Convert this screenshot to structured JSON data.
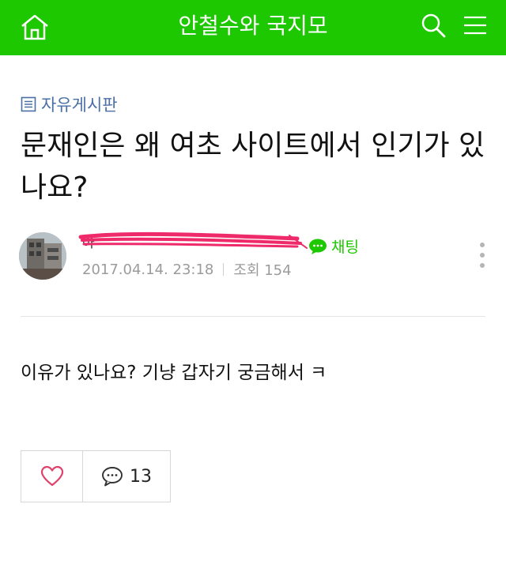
{
  "header": {
    "title": "안철수와 국지모",
    "home_icon": "home-icon",
    "search_icon": "search-icon",
    "menu_icon": "hamburger-menu-icon",
    "bg_color": "#1ec800"
  },
  "post": {
    "board": "자유게시판",
    "title": "문재인은 왜 여초 사이트에서 인기가 있나요?",
    "author_name": "아",
    "chat_label": "채팅",
    "date": "2017.04.14. 23:18",
    "views": "조회 154",
    "body": "이유가 있나요? 기냥 갑자기 궁금해서 ㅋ"
  },
  "actions": {
    "comment_count": "13"
  },
  "colors": {
    "accent": "#1ec800",
    "board_tag": "#4a6fa5",
    "like_heart": "#e0416b",
    "scribble": "#ee2a6b"
  }
}
